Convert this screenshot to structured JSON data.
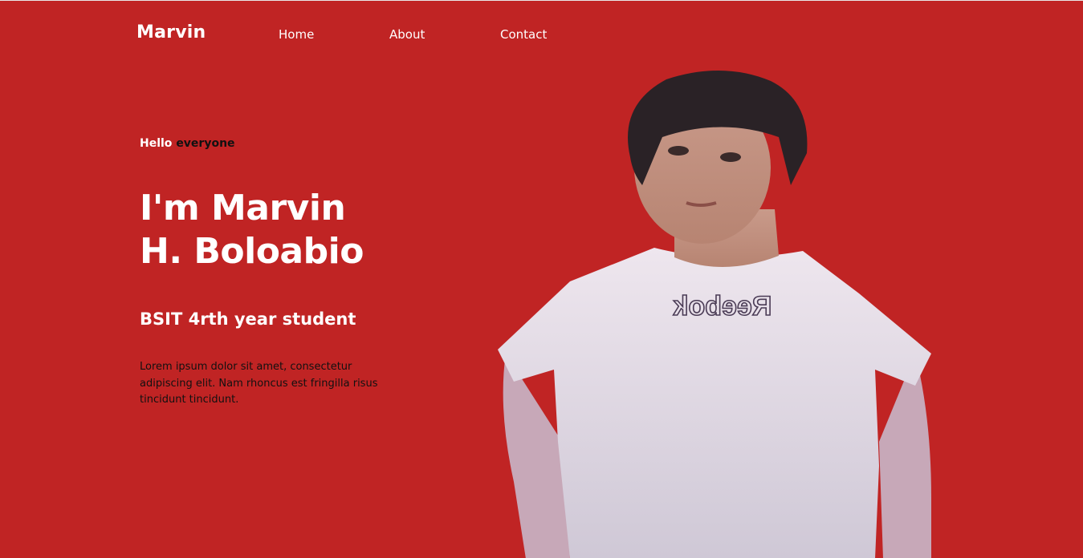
{
  "nav": {
    "logo": "Marvin",
    "links": [
      "Home",
      "About",
      "Contact"
    ]
  },
  "hero": {
    "greeting_white": "Hello",
    "greeting_dark": "everyone",
    "name_line1": "I'm Marvin",
    "name_line2": "H. Boloabio",
    "role": "BSIT 4rth year student",
    "description": "Lorem ipsum dolor sit amet, consectetur adipiscing elit. Nam rhoncus est fringilla risus tincidunt tincidunt.",
    "shirt_text": "Reebok"
  },
  "colors": {
    "background": "#c02424",
    "text_light": "#ffffff",
    "text_dark": "#111111",
    "shirt": "#e4dde6"
  }
}
